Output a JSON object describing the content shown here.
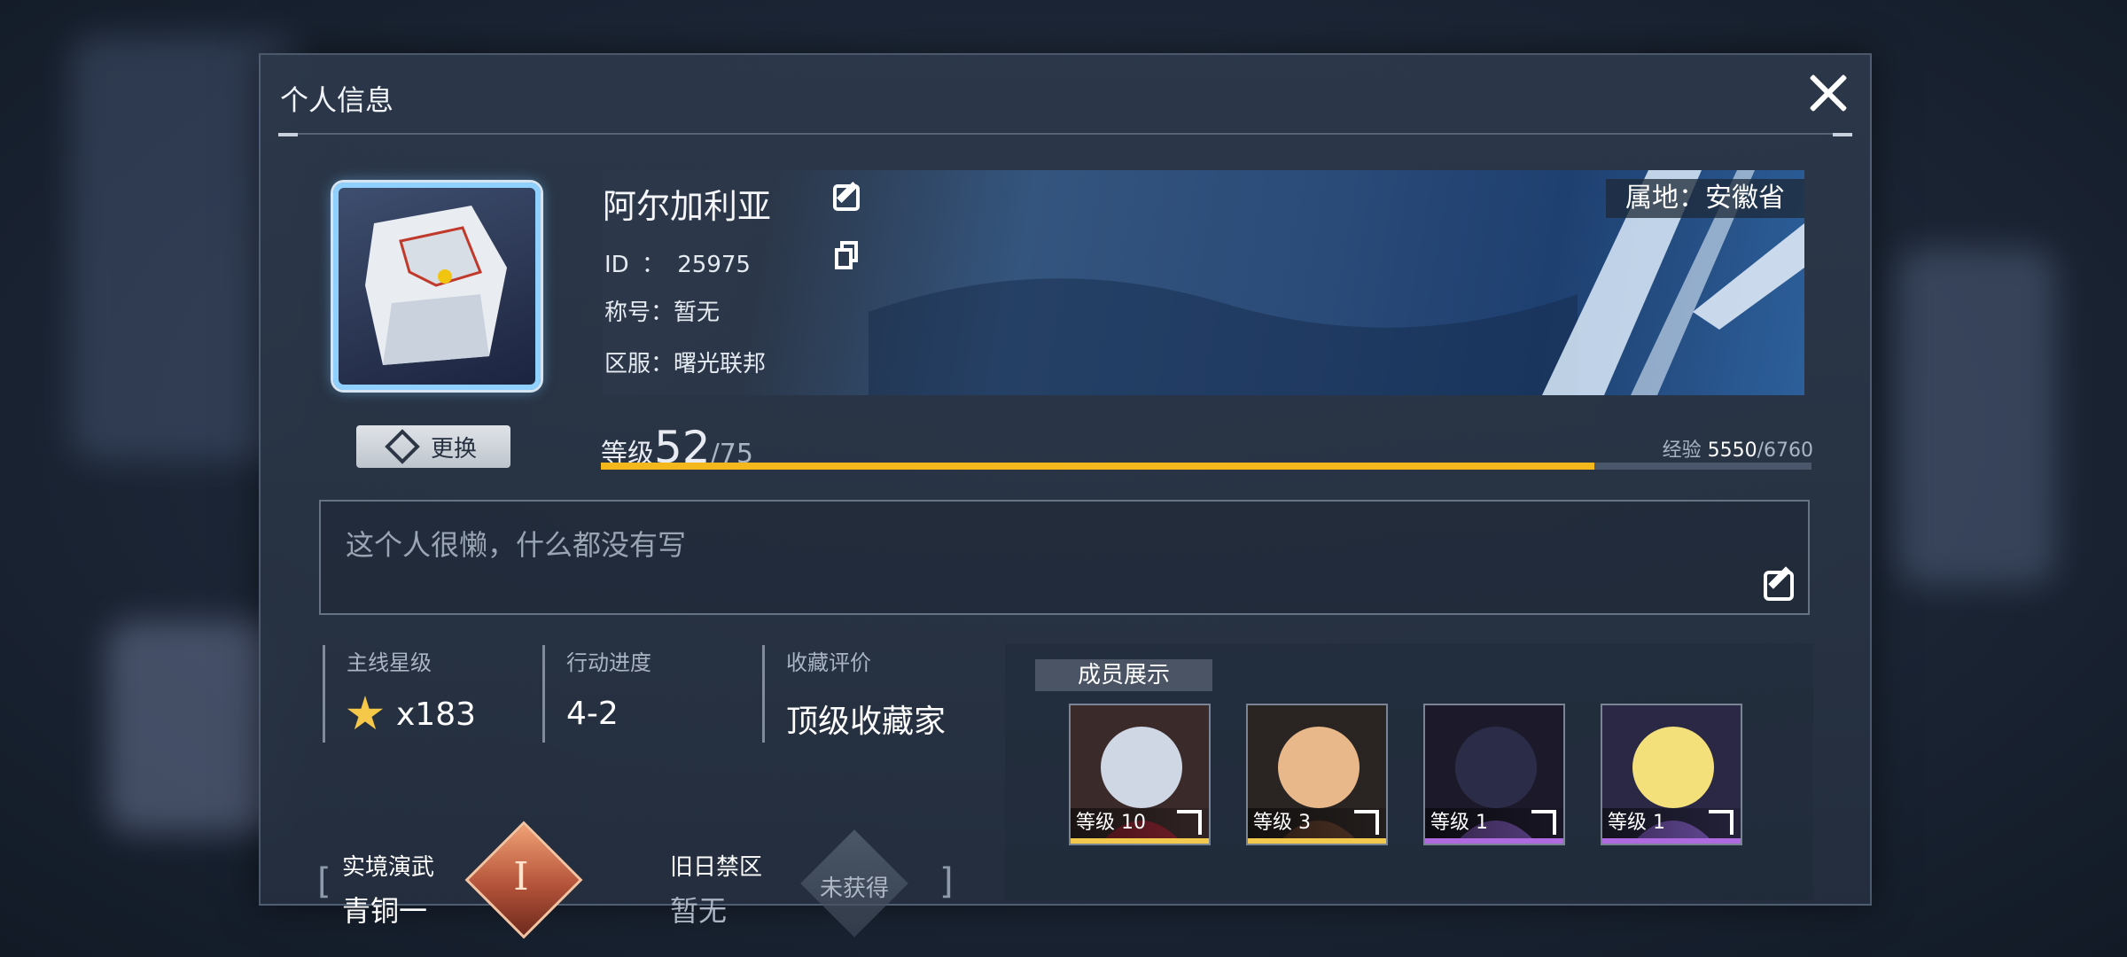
{
  "panel": {
    "title": "个人信息"
  },
  "profile": {
    "name": "阿尔加利亚",
    "id_label": "ID",
    "id_sep": "：",
    "id_value": "25975",
    "title_label": "称号：",
    "title_value": "暂无",
    "server_label": "区服：",
    "server_value": "曙光联邦",
    "region_tag": "属地：安徽省",
    "change_label": "更换"
  },
  "level": {
    "label": "等级",
    "value": "52",
    "max": "/75",
    "exp_label": "经验",
    "exp_current": "5550",
    "exp_max": "/6760",
    "progress": 0.821
  },
  "signature": {
    "text": "这个人很懒，什么都没有写"
  },
  "stats": [
    {
      "label": "主线星级",
      "value": "x183"
    },
    {
      "label": "行动进度",
      "value": "4-2"
    },
    {
      "label": "收藏评价",
      "value": "顶级收藏家"
    }
  ],
  "ranks": {
    "open_bracket": "[",
    "close_bracket": "]",
    "real": {
      "title": "实境演武",
      "value": "青铜一",
      "badge_numeral": "I"
    },
    "old": {
      "title": "旧日禁区",
      "value": "暂无",
      "badge_text": "未获得"
    }
  },
  "members": {
    "label": "成员展示",
    "items": [
      {
        "level_text": "等级 10",
        "strip_color": "#f2c94c",
        "portrait_colors": [
          "#cfd6e4",
          "#8a2430",
          "#3a2a2a"
        ]
      },
      {
        "level_text": "等级 3",
        "strip_color": "#f2c94c",
        "portrait_colors": [
          "#e8b88a",
          "#5a3a2a",
          "#2a2422"
        ]
      },
      {
        "level_text": "等级 1",
        "strip_color": "#b06ae0",
        "portrait_colors": [
          "#2b2d48",
          "#6a4c9a",
          "#1c1a2a"
        ]
      },
      {
        "level_text": "等级 1",
        "strip_color": "#b06ae0",
        "portrait_colors": [
          "#f4e07a",
          "#7a5ab8",
          "#2a2844"
        ]
      }
    ]
  },
  "colors": {
    "accent_bar": "#f4b81c",
    "panel_bg": "#2c384a"
  }
}
